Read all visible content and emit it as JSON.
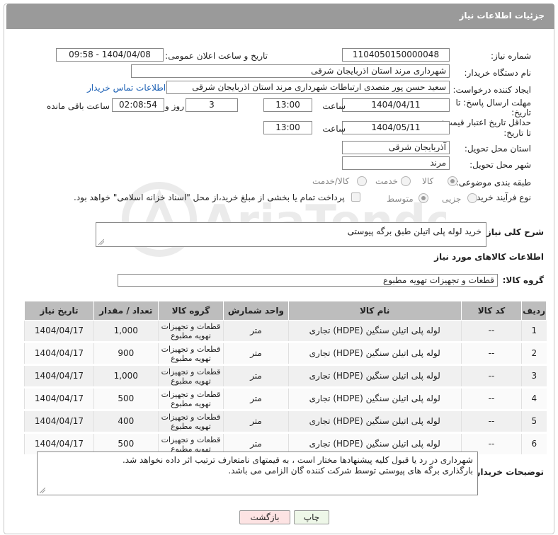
{
  "header": {
    "title": "جزئیات اطلاعات نیاز"
  },
  "form": {
    "need_number_label": "شماره نیاز:",
    "need_number": "1104050150000048",
    "announce_label": "تاریخ و ساعت اعلان عمومی:",
    "announce_value": "1404/04/08 - 09:58",
    "buyer_org_label": "نام دستگاه خریدار:",
    "buyer_org": "شهرداری مرند استان اذربایجان شرقی",
    "requester_label": "ایجاد کننده درخواست:",
    "requester": "سعید حسن پور متصدی ارتباطات شهرداری مرند استان اذربایجان شرقی",
    "contact_link": "اطلاعات تماس خریدار",
    "deadline_label_1": "مهلت ارسال پاسخ: تا",
    "deadline_label_2": "تاریخ:",
    "deadline_date": "1404/04/11",
    "time_label": "ساعت",
    "deadline_time": "13:00",
    "days_value": "3",
    "days_label": "روز و",
    "remaining_time": "02:08:54",
    "remaining_label": "ساعت باقی مانده",
    "min_price_label_1": "حداقل تاریخ اعتبار قیمت:",
    "min_price_label_2": "تا تاریخ:",
    "min_price_date": "1404/05/11",
    "min_price_time": "13:00",
    "province_label": "استان محل تحویل:",
    "province": "آذربایجان شرقی",
    "city_label": "شهر محل تحویل:",
    "city": "مرند",
    "category_label": "طبقه بندی موضوعی:",
    "category_options": [
      "کالا",
      "خدمت",
      "کالا/خدمت"
    ],
    "process_label": "نوع فرآیند خرید :",
    "process_options": [
      "جزیی",
      "متوسط"
    ],
    "payment_note": "پرداخت تمام یا بخشی از مبلغ خرید،از محل \"اسناد خزانه اسلامی\" خواهد بود."
  },
  "description": {
    "label": "شرح کلی نیاز:",
    "value": "خرید لوله پلی اتیلن طبق برگه پیوستی"
  },
  "goods": {
    "section_title": "اطلاعات کالاهای مورد نیاز",
    "group_label": "گروه کالا:",
    "group_value": "قطعات و تجهیزات تهویه مطبوع",
    "columns": [
      "ردیف",
      "کد کالا",
      "نام کالا",
      "واحد شمارش",
      "گروه کالا",
      "تعداد / مقدار",
      "تاریخ نیاز"
    ],
    "rows": [
      [
        "1",
        "--",
        "لوله پلی اتیلن سنگین (HDPE) تجاری",
        "متر",
        "قطعات و تجهیزات تهویه مطبوع",
        "1,000",
        "1404/04/17"
      ],
      [
        "2",
        "--",
        "لوله پلی اتیلن سنگین (HDPE) تجاری",
        "متر",
        "قطعات و تجهیزات تهویه مطبوع",
        "900",
        "1404/04/17"
      ],
      [
        "3",
        "--",
        "لوله پلی اتیلن سنگین (HDPE) تجاری",
        "متر",
        "قطعات و تجهیزات تهویه مطبوع",
        "1,000",
        "1404/04/17"
      ],
      [
        "4",
        "--",
        "لوله پلی اتیلن سنگین (HDPE) تجاری",
        "متر",
        "قطعات و تجهیزات تهویه مطبوع",
        "500",
        "1404/04/17"
      ],
      [
        "5",
        "--",
        "لوله پلی اتیلن سنگین (HDPE) تجاری",
        "متر",
        "قطعات و تجهیزات تهویه مطبوع",
        "400",
        "1404/04/17"
      ],
      [
        "6",
        "--",
        "لوله پلی اتیلن سنگین (HDPE) تجاری",
        "متر",
        "قطعات و تجهیزات تهویه مطبوع",
        "500",
        "1404/04/17"
      ]
    ]
  },
  "buyer_notes": {
    "label": "توضیحات خریدار:",
    "line1": "شهرداری در رد یا قبول کلیه پیشنهادها مختار  است ، به قیمتهای نامتعارف ترتیب اثر داده نخواهد شد.",
    "line2": "بارگذاری برگه های پیوستی توسط شرکت کننده گان الزامی می باشد."
  },
  "buttons": {
    "print": "چاپ",
    "back": "بازگشت"
  },
  "watermark": {
    "text": "AriaTender.net",
    "color": "#9a9a9a"
  }
}
